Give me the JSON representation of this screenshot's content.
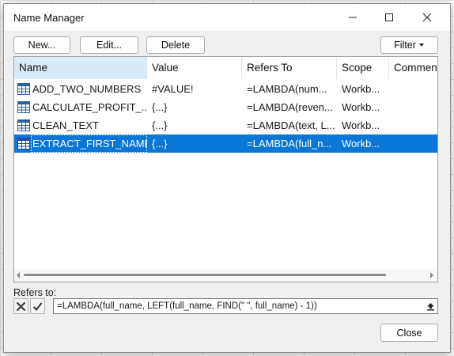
{
  "dialog": {
    "title": "Name Manager"
  },
  "toolbar": {
    "new_label": "New...",
    "edit_label": "Edit...",
    "delete_label": "Delete",
    "filter_label": "Filter"
  },
  "list": {
    "columns": [
      "Name",
      "Value",
      "Refers To",
      "Scope",
      "Comment"
    ],
    "rows": [
      {
        "name": "ADD_TWO_NUMBERS",
        "value": "#VALUE!",
        "refers_to": "=LAMBDA(num...",
        "scope": "Workb...",
        "comment": ""
      },
      {
        "name": "CALCULATE_PROFIT_...",
        "value": "{...}",
        "refers_to": "=LAMBDA(reven...",
        "scope": "Workb...",
        "comment": ""
      },
      {
        "name": "CLEAN_TEXT",
        "value": "{...}",
        "refers_to": "=LAMBDA(text, L...",
        "scope": "Workb...",
        "comment": ""
      },
      {
        "name": "EXTRACT_FIRST_NAME",
        "value": "{...}",
        "refers_to": "=LAMBDA(full_n...",
        "scope": "Workb...",
        "comment": ""
      }
    ],
    "selected_index": 3
  },
  "refers_to": {
    "label": "Refers to:",
    "value": "=LAMBDA(full_name, LEFT(full_name, FIND(\" \", full_name) - 1))"
  },
  "footer": {
    "close_label": "Close"
  },
  "colors": {
    "selection": "#0a77d8",
    "header_highlight": "#d9ebf9",
    "dialog_bg": "#f0f0f0"
  }
}
